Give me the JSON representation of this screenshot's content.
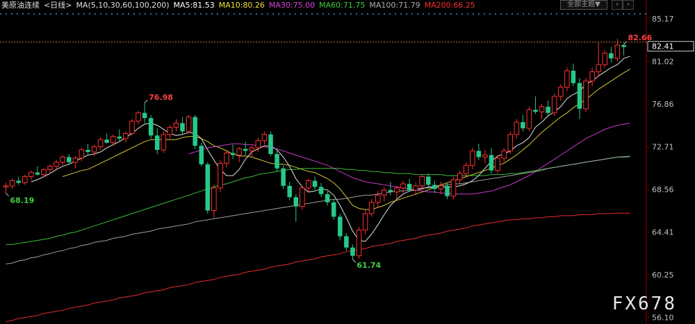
{
  "header": {
    "symbol": "美原油连续",
    "period": "<日线>",
    "ma_params": "MA(5,10,30,60,100,200)",
    "ma_values": [
      {
        "label": "MA5:81.53",
        "color": "#ffffff"
      },
      {
        "label": "MA10:80.26",
        "color": "#f0e03a"
      },
      {
        "label": "MA30:75.00",
        "color": "#e040e0"
      },
      {
        "label": "MA60:71.75",
        "color": "#40d040"
      },
      {
        "label": "MA100:71.79",
        "color": "#b0b0b0"
      },
      {
        "label": "MA200:66.25",
        "color": "#ff3030"
      }
    ],
    "theme_button": "全部主题▼",
    "window_buttons": [
      "‹",
      "›"
    ]
  },
  "watermark": "FX678",
  "chart_data": {
    "type": "candlestick",
    "y_axis_ticks": [
      85.17,
      81.02,
      76.86,
      72.71,
      68.56,
      64.41,
      60.25,
      56.1
    ],
    "ylim": [
      55.6,
      85.9
    ],
    "current_price": 82.41,
    "annotations": [
      {
        "label": "82.66",
        "kind": "high",
        "color": "#ff4040"
      },
      {
        "label": "76.98",
        "kind": "high",
        "color": "#ff4040"
      },
      {
        "label": "68.19",
        "kind": "low",
        "color": "#40d040"
      },
      {
        "label": "61.74",
        "kind": "low",
        "color": "#40d040"
      }
    ],
    "candles": [
      [
        68.8,
        69.2,
        68.19,
        68.9
      ],
      [
        68.9,
        69.6,
        68.6,
        69.4
      ],
      [
        69.4,
        69.8,
        69.0,
        69.2
      ],
      [
        69.2,
        70.0,
        69.0,
        69.8
      ],
      [
        69.8,
        70.4,
        69.5,
        70.2
      ],
      [
        70.2,
        70.8,
        69.9,
        70.0
      ],
      [
        70.0,
        70.6,
        69.7,
        70.5
      ],
      [
        70.5,
        71.0,
        70.1,
        70.8
      ],
      [
        70.8,
        71.4,
        70.4,
        71.2
      ],
      [
        71.2,
        71.9,
        70.9,
        71.7
      ],
      [
        71.7,
        72.0,
        71.0,
        71.2
      ],
      [
        71.2,
        71.8,
        70.6,
        71.6
      ],
      [
        71.6,
        72.6,
        71.3,
        72.4
      ],
      [
        72.4,
        73.0,
        72.0,
        72.2
      ],
      [
        72.2,
        72.9,
        71.8,
        72.7
      ],
      [
        72.7,
        73.6,
        72.4,
        73.4
      ],
      [
        73.4,
        74.0,
        73.0,
        73.1
      ],
      [
        73.1,
        73.9,
        72.8,
        73.7
      ],
      [
        73.7,
        74.4,
        73.2,
        73.5
      ],
      [
        73.5,
        74.2,
        73.1,
        74.0
      ],
      [
        74.0,
        75.4,
        73.8,
        75.2
      ],
      [
        75.2,
        76.2,
        74.9,
        76.0
      ],
      [
        76.0,
        76.98,
        75.0,
        75.5
      ],
      [
        75.5,
        75.8,
        73.5,
        73.8
      ],
      [
        73.8,
        74.5,
        72.0,
        72.4
      ],
      [
        72.4,
        74.2,
        72.1,
        73.9
      ],
      [
        73.9,
        74.8,
        73.5,
        74.6
      ],
      [
        74.6,
        75.4,
        74.2,
        75.0
      ],
      [
        75.0,
        75.6,
        73.9,
        74.2
      ],
      [
        74.2,
        75.8,
        74.0,
        75.6
      ],
      [
        75.6,
        75.8,
        72.5,
        72.8
      ],
      [
        72.8,
        73.1,
        70.8,
        71.0
      ],
      [
        71.0,
        71.2,
        66.2,
        66.5
      ],
      [
        66.5,
        69.0,
        65.8,
        68.7
      ],
      [
        68.7,
        71.4,
        68.3,
        71.1
      ],
      [
        71.1,
        72.4,
        70.7,
        72.1
      ],
      [
        72.1,
        72.9,
        71.5,
        71.9
      ],
      [
        71.9,
        72.7,
        71.2,
        72.5
      ],
      [
        72.5,
        73.2,
        71.9,
        72.3
      ],
      [
        72.3,
        72.8,
        71.7,
        72.6
      ],
      [
        72.6,
        73.6,
        72.2,
        73.3
      ],
      [
        73.3,
        74.2,
        72.9,
        73.9
      ],
      [
        73.9,
        74.2,
        71.8,
        72.0
      ],
      [
        72.0,
        72.4,
        70.3,
        70.6
      ],
      [
        70.6,
        70.9,
        68.6,
        68.9
      ],
      [
        68.9,
        69.3,
        67.5,
        67.8
      ],
      [
        67.8,
        68.1,
        65.4,
        66.9
      ],
      [
        66.9,
        68.9,
        66.6,
        68.7
      ],
      [
        68.7,
        69.6,
        68.3,
        69.4
      ],
      [
        69.4,
        69.8,
        68.5,
        68.8
      ],
      [
        68.8,
        69.2,
        67.8,
        68.1
      ],
      [
        68.1,
        68.4,
        67.0,
        67.3
      ],
      [
        67.3,
        67.6,
        65.6,
        65.9
      ],
      [
        65.9,
        66.2,
        63.6,
        64.0
      ],
      [
        64.0,
        64.3,
        62.6,
        62.9
      ],
      [
        62.9,
        63.2,
        61.74,
        62.1
      ],
      [
        62.1,
        64.9,
        61.8,
        64.6
      ],
      [
        64.6,
        66.6,
        64.2,
        66.2
      ],
      [
        66.2,
        67.6,
        65.9,
        67.3
      ],
      [
        67.3,
        68.4,
        66.8,
        68.0
      ],
      [
        68.0,
        68.8,
        67.4,
        68.5
      ],
      [
        68.5,
        69.3,
        68.0,
        68.3
      ],
      [
        68.3,
        68.9,
        67.6,
        68.7
      ],
      [
        68.7,
        69.4,
        68.2,
        69.1
      ],
      [
        69.1,
        69.6,
        68.3,
        68.5
      ],
      [
        68.5,
        69.2,
        68.0,
        68.9
      ],
      [
        68.9,
        70.0,
        68.5,
        69.8
      ],
      [
        69.8,
        70.1,
        68.7,
        69.0
      ],
      [
        69.0,
        69.4,
        68.2,
        68.6
      ],
      [
        68.6,
        69.3,
        68.1,
        68.9
      ],
      [
        68.9,
        69.2,
        67.6,
        67.9
      ],
      [
        67.9,
        69.8,
        67.6,
        69.5
      ],
      [
        69.5,
        70.4,
        69.1,
        70.1
      ],
      [
        70.1,
        71.2,
        69.7,
        70.9
      ],
      [
        70.9,
        72.6,
        70.5,
        72.3
      ],
      [
        72.3,
        73.0,
        71.4,
        71.7
      ],
      [
        71.7,
        72.4,
        71.1,
        71.9
      ],
      [
        71.9,
        72.6,
        70.1,
        70.4
      ],
      [
        70.4,
        71.9,
        70.1,
        71.6
      ],
      [
        71.6,
        72.6,
        71.2,
        72.3
      ],
      [
        72.3,
        74.2,
        72.0,
        73.9
      ],
      [
        73.9,
        75.4,
        73.5,
        75.1
      ],
      [
        75.1,
        75.8,
        74.2,
        74.5
      ],
      [
        74.5,
        76.6,
        74.2,
        76.3
      ],
      [
        76.3,
        77.6,
        75.9,
        76.1
      ],
      [
        76.1,
        76.9,
        75.4,
        76.6
      ],
      [
        76.6,
        77.2,
        75.7,
        76.0
      ],
      [
        76.0,
        77.9,
        75.7,
        77.6
      ],
      [
        77.6,
        78.8,
        77.2,
        78.5
      ],
      [
        78.5,
        80.4,
        78.1,
        80.1
      ],
      [
        80.1,
        80.8,
        78.6,
        78.9
      ],
      [
        78.9,
        79.4,
        75.4,
        76.4
      ],
      [
        76.4,
        79.4,
        76.1,
        79.1
      ],
      [
        79.1,
        80.4,
        78.6,
        80.0
      ],
      [
        80.0,
        82.9,
        79.6,
        80.7
      ],
      [
        80.7,
        82.1,
        80.4,
        81.8
      ],
      [
        81.8,
        82.4,
        80.9,
        81.3
      ],
      [
        81.3,
        83.2,
        81.0,
        82.6
      ],
      [
        82.6,
        82.66,
        81.6,
        82.41
      ]
    ],
    "moving_averages": [
      {
        "name": "MA5",
        "color": "#ffffff",
        "values": [
          null,
          null,
          null,
          null,
          69.3,
          69.5,
          69.8,
          70.1,
          70.5,
          70.8,
          71.0,
          71.3,
          71.6,
          71.9,
          72.0,
          72.2,
          72.6,
          72.9,
          73.2,
          73.6,
          74.0,
          74.5,
          74.9,
          75.0,
          74.8,
          74.4,
          74.0,
          73.8,
          73.9,
          74.1,
          74.0,
          73.5,
          72.4,
          71.4,
          70.5,
          69.9,
          69.9,
          70.5,
          71.5,
          72.2,
          72.5,
          72.8,
          72.8,
          72.4,
          71.7,
          70.8,
          69.6,
          68.8,
          68.3,
          68.4,
          68.6,
          68.5,
          68.0,
          67.0,
          65.8,
          64.5,
          63.6,
          63.5,
          64.2,
          65.1,
          66.1,
          67.0,
          67.6,
          68.1,
          68.4,
          68.5,
          68.6,
          68.8,
          68.8,
          68.8,
          68.8,
          68.8,
          68.9,
          69.1,
          69.4,
          69.9,
          70.6,
          71.3,
          71.8,
          72.0,
          72.3,
          72.8,
          73.1,
          73.6,
          74.6,
          75.1,
          75.7,
          76.1,
          76.6,
          77.4,
          77.8,
          78.1,
          78.8,
          79.1,
          79.6,
          80.0,
          80.4,
          80.7,
          81.3,
          81.5
        ]
      },
      {
        "name": "MA10",
        "color": "#f0e03a",
        "values": [
          null,
          null,
          null,
          null,
          null,
          null,
          null,
          null,
          null,
          69.8,
          70.0,
          70.2,
          70.4,
          70.5,
          70.8,
          71.1,
          71.4,
          71.7,
          72.0,
          72.3,
          72.6,
          72.9,
          73.2,
          73.4,
          73.4,
          73.4,
          73.4,
          73.4,
          73.6,
          73.7,
          73.7,
          73.5,
          73.2,
          72.8,
          72.6,
          72.3,
          72.0,
          71.8,
          71.8,
          71.7,
          71.5,
          71.3,
          71.1,
          71.0,
          71.0,
          70.9,
          70.7,
          70.5,
          70.3,
          70.2,
          69.9,
          69.6,
          69.2,
          68.6,
          67.8,
          67.0,
          66.7,
          66.6,
          66.6,
          66.8,
          67.0,
          67.3,
          67.5,
          67.7,
          67.9,
          68.1,
          68.3,
          68.5,
          68.8,
          69.0,
          69.2,
          69.4,
          69.6,
          69.8,
          70.0,
          70.2,
          70.4,
          70.6,
          70.9,
          71.1,
          71.5,
          71.9,
          72.4,
          72.9,
          73.5,
          74.1,
          74.6,
          75.1,
          75.6,
          76.0,
          76.5,
          76.9,
          77.3,
          77.8,
          78.3,
          78.7,
          79.1,
          79.5,
          79.9,
          80.26
        ]
      },
      {
        "name": "MA30",
        "color": "#e040e0",
        "values": [
          null,
          null,
          null,
          null,
          null,
          null,
          null,
          null,
          null,
          null,
          null,
          null,
          null,
          null,
          null,
          null,
          null,
          null,
          null,
          null,
          null,
          null,
          null,
          null,
          null,
          null,
          null,
          null,
          null,
          72.0,
          72.2,
          72.4,
          72.6,
          72.7,
          72.8,
          72.9,
          73.0,
          73.0,
          72.9,
          72.9,
          72.8,
          72.7,
          72.6,
          72.5,
          72.3,
          72.1,
          71.9,
          71.7,
          71.5,
          71.3,
          71.1,
          70.9,
          70.6,
          70.3,
          70.0,
          69.7,
          69.5,
          69.3,
          69.2,
          69.1,
          69.0,
          68.9,
          68.8,
          68.7,
          68.6,
          68.5,
          68.4,
          68.3,
          68.3,
          68.2,
          68.2,
          68.1,
          68.1,
          68.1,
          68.1,
          68.2,
          68.3,
          68.4,
          68.6,
          68.8,
          69.0,
          69.3,
          69.6,
          69.9,
          70.3,
          70.7,
          71.1,
          71.5,
          71.9,
          72.3,
          72.7,
          73.1,
          73.5,
          73.8,
          74.1,
          74.4,
          74.6,
          74.8,
          74.9,
          75.0
        ]
      },
      {
        "name": "MA60",
        "color": "#40d040",
        "values": [
          63.2,
          63.2,
          63.3,
          63.4,
          63.5,
          63.6,
          63.7,
          63.8,
          64.0,
          64.1,
          64.3,
          64.4,
          64.6,
          64.8,
          65.0,
          65.2,
          65.4,
          65.6,
          65.8,
          66.0,
          66.2,
          66.4,
          66.6,
          66.8,
          67.0,
          67.2,
          67.4,
          67.6,
          67.8,
          68.0,
          68.2,
          68.4,
          68.6,
          68.8,
          69.0,
          69.1,
          69.3,
          69.5,
          69.7,
          69.8,
          70.0,
          70.1,
          70.2,
          70.3,
          70.4,
          70.5,
          70.5,
          70.6,
          70.6,
          70.6,
          70.6,
          70.6,
          70.6,
          70.6,
          70.5,
          70.5,
          70.4,
          70.4,
          70.3,
          70.3,
          70.2,
          70.2,
          70.1,
          70.1,
          70.1,
          70.0,
          70.0,
          70.0,
          70.0,
          70.0,
          69.9,
          69.9,
          69.9,
          69.9,
          69.9,
          69.9,
          69.9,
          70.0,
          70.0,
          70.0,
          70.1,
          70.1,
          70.2,
          70.3,
          70.4,
          70.5,
          70.6,
          70.7,
          70.8,
          70.9,
          71.0,
          71.1,
          71.2,
          71.3,
          71.4,
          71.5,
          71.6,
          71.7,
          71.7,
          71.75
        ]
      },
      {
        "name": "MA100",
        "color": "#b0b0b0",
        "values": [
          61.3,
          61.4,
          61.6,
          61.7,
          61.9,
          62.0,
          62.2,
          62.3,
          62.5,
          62.6,
          62.8,
          62.9,
          63.1,
          63.2,
          63.4,
          63.5,
          63.6,
          63.8,
          63.9,
          64.0,
          64.2,
          64.3,
          64.4,
          64.5,
          64.7,
          64.8,
          64.9,
          65.0,
          65.1,
          65.2,
          65.4,
          65.5,
          65.6,
          65.7,
          65.8,
          65.9,
          66.0,
          66.1,
          66.2,
          66.3,
          66.4,
          66.5,
          66.6,
          66.7,
          66.8,
          66.9,
          67.0,
          67.1,
          67.2,
          67.3,
          67.4,
          67.5,
          67.6,
          67.6,
          67.7,
          67.8,
          67.9,
          68.0,
          68.0,
          68.1,
          68.2,
          68.3,
          68.4,
          68.4,
          68.5,
          68.6,
          68.7,
          68.7,
          68.8,
          68.9,
          69.0,
          69.1,
          69.1,
          69.2,
          69.3,
          69.4,
          69.5,
          69.6,
          69.7,
          69.8,
          69.9,
          70.0,
          70.1,
          70.2,
          70.3,
          70.4,
          70.6,
          70.7,
          70.8,
          70.9,
          71.0,
          71.1,
          71.2,
          71.3,
          71.4,
          71.5,
          71.6,
          71.7,
          71.75,
          71.79
        ]
      },
      {
        "name": "MA200",
        "color": "#ff3030",
        "values": [
          55.7,
          55.8,
          56.0,
          56.1,
          56.2,
          56.3,
          56.5,
          56.6,
          56.7,
          56.8,
          57.0,
          57.1,
          57.2,
          57.3,
          57.5,
          57.6,
          57.7,
          57.8,
          58.0,
          58.1,
          58.2,
          58.3,
          58.5,
          58.6,
          58.7,
          58.8,
          59.0,
          59.1,
          59.2,
          59.3,
          59.5,
          59.6,
          59.7,
          59.8,
          60.0,
          60.1,
          60.2,
          60.3,
          60.5,
          60.6,
          60.7,
          60.8,
          61.0,
          61.1,
          61.2,
          61.3,
          61.5,
          61.6,
          61.7,
          61.8,
          62.0,
          62.1,
          62.2,
          62.3,
          62.5,
          62.6,
          62.7,
          62.8,
          63.0,
          63.1,
          63.2,
          63.3,
          63.5,
          63.6,
          63.7,
          63.8,
          64.0,
          64.1,
          64.2,
          64.3,
          64.5,
          64.6,
          64.7,
          64.8,
          65.0,
          65.1,
          65.2,
          65.3,
          65.4,
          65.5,
          65.6,
          65.6,
          65.7,
          65.7,
          65.8,
          65.8,
          65.9,
          65.9,
          66.0,
          66.0,
          66.0,
          66.1,
          66.1,
          66.1,
          66.2,
          66.2,
          66.2,
          66.25,
          66.25,
          66.25
        ]
      }
    ]
  }
}
